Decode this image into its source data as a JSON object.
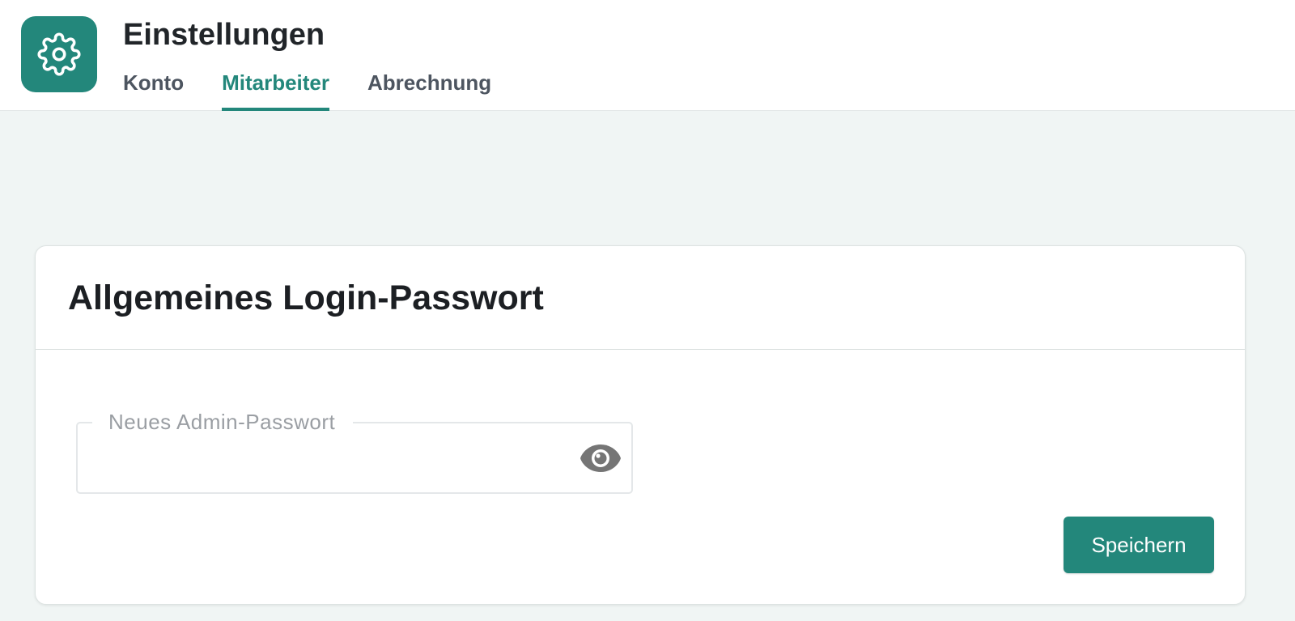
{
  "colors": {
    "accent": "#23877b",
    "background": "#f0f5f4"
  },
  "header": {
    "icon": "gear-icon",
    "title": "Einstellungen",
    "tabs": [
      {
        "label": "Konto",
        "active": false
      },
      {
        "label": "Mitarbeiter",
        "active": true
      },
      {
        "label": "Abrechnung",
        "active": false
      }
    ]
  },
  "card": {
    "title": "Allgemeines Login-Passwort",
    "password_field": {
      "label": "Neues Admin-Passwort",
      "value": "",
      "toggle_icon": "eye-icon"
    },
    "save_label": "Speichern"
  }
}
